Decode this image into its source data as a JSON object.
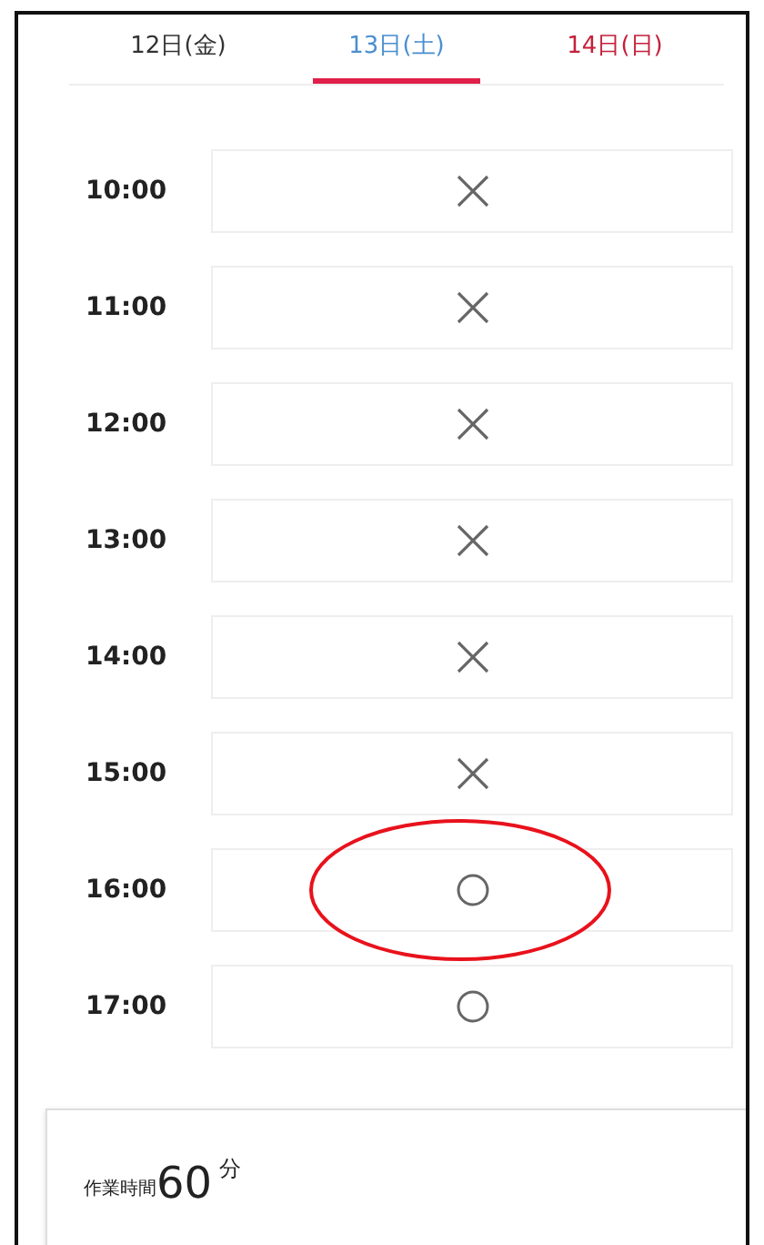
{
  "tabs": [
    {
      "label": "12日(金)",
      "color": "#333333",
      "selected": false
    },
    {
      "label": "13日(土)",
      "color": "#4a8fd0",
      "selected": true
    },
    {
      "label": "14日(日)",
      "color": "#c4203a",
      "selected": false
    }
  ],
  "slots": [
    {
      "time": "10:00",
      "kind": "unavailable",
      "circled": false
    },
    {
      "time": "11:00",
      "kind": "unavailable",
      "circled": false
    },
    {
      "time": "12:00",
      "kind": "unavailable",
      "circled": false
    },
    {
      "time": "13:00",
      "kind": "unavailable",
      "circled": false
    },
    {
      "time": "14:00",
      "kind": "unavailable",
      "circled": false
    },
    {
      "time": "15:00",
      "kind": "unavailable",
      "circled": false
    },
    {
      "time": "16:00",
      "kind": "available",
      "circled": true
    },
    {
      "time": "17:00",
      "kind": "available",
      "circled": false
    }
  ],
  "work_time": {
    "label": "作業時間",
    "value": "60",
    "unit": "分"
  }
}
